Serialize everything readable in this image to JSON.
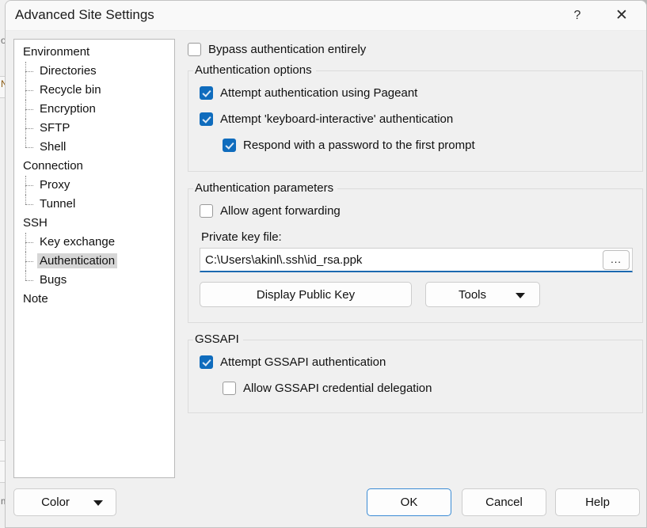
{
  "window": {
    "title": "Advanced Site Settings",
    "help_caption_icon": "question-mark-icon",
    "help_caption_glyph": "?",
    "close_caption_icon": "close-icon",
    "close_caption_glyph": "✕"
  },
  "colors": {
    "accent": "#0f6cbd",
    "focus_underline": "#1b69b0",
    "default_button_border": "#3a8bd4",
    "selection": "#d6d6d6",
    "window_background": "#f0f0f0"
  },
  "tree": {
    "items": [
      {
        "label": "Environment",
        "level": 0,
        "selected": false,
        "last": false
      },
      {
        "label": "Directories",
        "level": 1,
        "selected": false,
        "last": false
      },
      {
        "label": "Recycle bin",
        "level": 1,
        "selected": false,
        "last": false
      },
      {
        "label": "Encryption",
        "level": 1,
        "selected": false,
        "last": false
      },
      {
        "label": "SFTP",
        "level": 1,
        "selected": false,
        "last": false
      },
      {
        "label": "Shell",
        "level": 1,
        "selected": false,
        "last": true
      },
      {
        "label": "Connection",
        "level": 0,
        "selected": false,
        "last": false
      },
      {
        "label": "Proxy",
        "level": 1,
        "selected": false,
        "last": false
      },
      {
        "label": "Tunnel",
        "level": 1,
        "selected": false,
        "last": true
      },
      {
        "label": "SSH",
        "level": 0,
        "selected": false,
        "last": false
      },
      {
        "label": "Key exchange",
        "level": 1,
        "selected": false,
        "last": false
      },
      {
        "label": "Authentication",
        "level": 1,
        "selected": true,
        "last": false
      },
      {
        "label": "Bugs",
        "level": 1,
        "selected": false,
        "last": true
      },
      {
        "label": "Note",
        "level": 0,
        "selected": false,
        "last": false
      }
    ]
  },
  "main": {
    "bypass": {
      "label": "Bypass authentication entirely",
      "checked": false
    },
    "auth_options": {
      "title": "Authentication options",
      "pageant": {
        "label": "Attempt authentication using Pageant",
        "checked": true
      },
      "keyboard_interactive": {
        "label": "Attempt 'keyboard-interactive' authentication",
        "checked": true
      },
      "respond_password": {
        "label": "Respond with a password to the first prompt",
        "checked": true
      }
    },
    "auth_parameters": {
      "title": "Authentication parameters",
      "agent_forwarding": {
        "label": "Allow agent forwarding",
        "checked": false
      },
      "private_key_label": "Private key file:",
      "private_key_value": "C:\\Users\\akinl\\.ssh\\id_rsa.ppk",
      "private_key_placeholder": "",
      "browse_label": "...",
      "display_public_key_label": "Display Public Key",
      "tools_label": "Tools"
    },
    "gssapi": {
      "title": "GSSAPI",
      "attempt": {
        "label": "Attempt GSSAPI authentication",
        "checked": true
      },
      "delegation": {
        "label": "Allow GSSAPI credential delegation",
        "checked": false
      }
    }
  },
  "footer": {
    "color_label": "Color",
    "ok_label": "OK",
    "cancel_label": "Cancel",
    "help_label": "Help"
  }
}
